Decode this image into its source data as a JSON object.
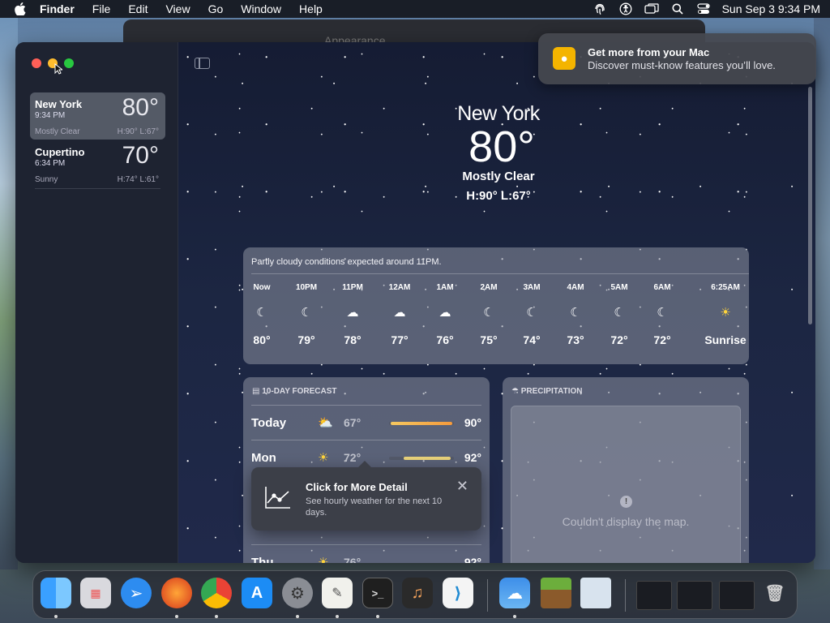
{
  "menubar": {
    "app_name": "Finder",
    "menus": [
      "File",
      "Edit",
      "View",
      "Go",
      "Window",
      "Help"
    ],
    "datetime": "Sun Sep 3  9:34 PM"
  },
  "background_window": {
    "title": "Appearance"
  },
  "notification": {
    "title": "Get more from your Mac",
    "body": "Discover must-know features you’ll love."
  },
  "sidebar": {
    "cities": [
      {
        "name": "New York",
        "time": "9:34 PM",
        "temp": "80°",
        "condition": "Mostly Clear",
        "hilo": "H:90°  L:67°"
      },
      {
        "name": "Cupertino",
        "time": "6:34 PM",
        "temp": "70°",
        "condition": "Sunny",
        "hilo": "H:74°  L:61°"
      }
    ]
  },
  "hero": {
    "city": "New York",
    "temp": "80°",
    "condition": "Mostly Clear",
    "hilo": "H:90°  L:67°"
  },
  "hourly": {
    "summary": "Partly cloudy conditions expected around 11PM.",
    "hours": [
      {
        "label": "Now",
        "icon": "moon-icon",
        "temp": "80°"
      },
      {
        "label": "10PM",
        "icon": "moon-icon",
        "temp": "79°"
      },
      {
        "label": "11PM",
        "icon": "cloud-moon-icon",
        "temp": "78°"
      },
      {
        "label": "12AM",
        "icon": "cloud-moon-icon",
        "temp": "77°"
      },
      {
        "label": "1AM",
        "icon": "cloud-moon-icon",
        "temp": "76°"
      },
      {
        "label": "2AM",
        "icon": "moon-icon",
        "temp": "75°"
      },
      {
        "label": "3AM",
        "icon": "moon-icon",
        "temp": "74°"
      },
      {
        "label": "4AM",
        "icon": "moon-icon",
        "temp": "73°"
      },
      {
        "label": "5AM",
        "icon": "moon-icon",
        "temp": "72°"
      },
      {
        "label": "6AM",
        "icon": "moon-icon",
        "temp": "72°"
      },
      {
        "label": "6:25AM",
        "icon": "sunrise-icon",
        "temp": "Sunrise"
      }
    ]
  },
  "forecast": {
    "heading": "10-DAY FORECAST",
    "days": [
      {
        "day": "Today",
        "icon": "partly-cloudy-icon",
        "low": "67°",
        "high": "90°"
      },
      {
        "day": "Mon",
        "icon": "sun-icon",
        "low": "72°",
        "high": "92°"
      },
      {
        "day": "Thu",
        "icon": "sun-icon",
        "low": "76°",
        "high": "92°"
      }
    ]
  },
  "precipitation": {
    "heading": "PRECIPITATION",
    "map_message": "Couldn't display the map."
  },
  "tooltip": {
    "title": "Click for More Detail",
    "body": "See hourly weather for the next 10 days."
  },
  "dock": {
    "apps": [
      "Finder",
      "Launchpad",
      "Safari",
      "Firefox",
      "Chrome",
      "App Store",
      "System Settings",
      "TextEdit",
      "Terminal",
      "GarageBand",
      "Visual Studio Code",
      "Weather",
      "Minecraft",
      "Preview"
    ]
  }
}
